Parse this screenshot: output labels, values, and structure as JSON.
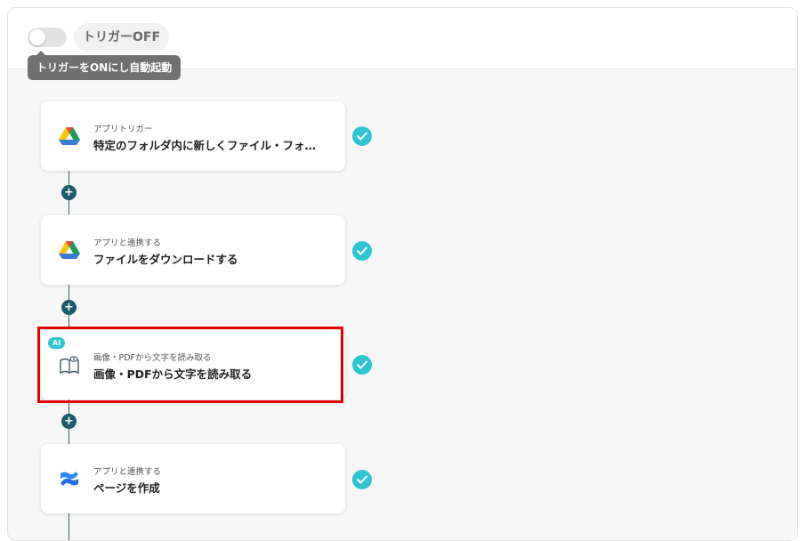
{
  "header": {
    "trigger_status": "トリガーOFF",
    "tooltip": "トリガーをONにし自動起動"
  },
  "flow": {
    "steps": [
      {
        "caption": "アプリトリガー",
        "title": "特定のフォルダ内に新しくファイル・フォ…",
        "icon": "google-drive-icon",
        "completed": true
      },
      {
        "caption": "アプリと連携する",
        "title": "ファイルをダウンロードする",
        "icon": "google-drive-icon",
        "completed": true
      },
      {
        "badge": "AI",
        "caption": "画像・PDFから文字を読み取る",
        "title": "画像・PDFから文字を読み取る",
        "icon": "ocr-book-icon",
        "completed": true,
        "highlighted": true
      },
      {
        "caption": "アプリと連携する",
        "title": "ページを作成",
        "icon": "confluence-icon",
        "completed": true
      }
    ],
    "add_symbol": "+"
  },
  "colors": {
    "check": "#2ec5d3",
    "connector": "#1a5a6a",
    "highlight": "#e00000",
    "drive_yellow": "#ffc107",
    "drive_green": "#1e9e55",
    "drive_blue": "#3a7bd5",
    "confluence_blue": "#1f6fe0"
  }
}
